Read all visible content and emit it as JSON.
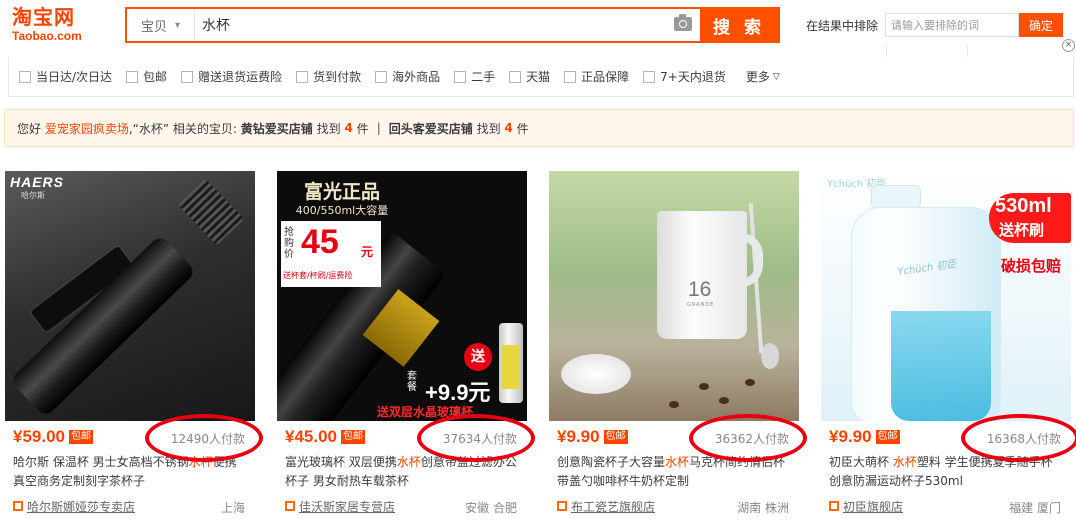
{
  "header": {
    "logo_cn": "淘宝网",
    "logo_en": "Taobao.com",
    "search_category": "宝贝",
    "search_query": "水杯",
    "search_button": "搜 索",
    "exclude_label": "在结果中排除",
    "exclude_placeholder": "请输入要排除的词",
    "exclude_button": "确定"
  },
  "filters": {
    "items": [
      {
        "label": "当日达/次日达"
      },
      {
        "label": "包邮"
      },
      {
        "label": "赠送退货运费险"
      },
      {
        "label": "货到付款"
      },
      {
        "label": "海外商品"
      },
      {
        "label": "二手"
      },
      {
        "label": "天猫"
      },
      {
        "label": "正品保障"
      },
      {
        "label": "7+天内退货"
      }
    ],
    "more": "更多"
  },
  "notice": {
    "greeting": "您好",
    "user": "爱宠家园疯卖场",
    "mid": ",“水杯” 相关的宝贝:",
    "shop1": "黄钻爱买店铺",
    "found1_pre": "找到",
    "count1": "4",
    "found1_post": "件",
    "divider": "|",
    "shop2": "回头客爱买店铺",
    "found2_pre": "找到",
    "count2": "4",
    "found2_post": "件"
  },
  "products": [
    {
      "price": "¥59.00",
      "badge": "包邮",
      "payers": "12490人付款",
      "title_pre": "哈尔斯 保温杯 男士女高档不锈钢",
      "title_hl": "水杯",
      "title_post": "便携真空商务定制刻字茶杯子",
      "shop": "哈尔斯娜娅莎专卖店",
      "location": "上海",
      "image": {
        "brand": "HAERS",
        "brand_sub": "哈尔斯"
      }
    },
    {
      "price": "¥45.00",
      "badge": "包邮",
      "payers": "37634人付款",
      "title_pre": "富光玻璃杯 双层便携",
      "title_hl": "水杯",
      "title_post": "创意带盖过滤办公杯子 男女耐热车载茶杯",
      "shop": "佳沃斯家居专营店",
      "location": "安徽 合肥",
      "image": {
        "title": "富光正品",
        "sub": "400/550ml大容量",
        "label": "抢购价",
        "price": "45",
        "unit": "元",
        "gift_note": "送杯套/杯刷/运费险",
        "gift_icon": "送",
        "gift_set": "套餐",
        "gift_price": "+9.9元",
        "gift_line": "送双层水晶玻璃杯"
      }
    },
    {
      "price": "¥9.90",
      "badge": "包邮",
      "payers": "36362人付款",
      "title_pre": "创意陶瓷杯子大容量",
      "title_hl": "水杯",
      "title_post": "马克杯简约情侣杯带盖勺咖啡杯牛奶杯定制",
      "shop": "布工瓷艺旗舰店",
      "location": "湖南 株洲",
      "image": {
        "mug_num": "16",
        "mug_sub": "GRANDE"
      }
    },
    {
      "price": "¥9.90",
      "badge": "包邮",
      "payers": "16368人付款",
      "title_pre": "初臣大萌杯 ",
      "title_hl": "水杯",
      "title_post": "塑料 学生便携夏季随手杯创意防漏运动杯子530ml",
      "shop": "初臣旗舰店",
      "location": "福建 厦门",
      "image": {
        "brand": "Ychüch 初臣",
        "sticker1": "530ml",
        "sticker2": "送杯刷",
        "sticker3": "破损包赔",
        "bottle_label": "Ychüch 初臣"
      }
    }
  ],
  "colors": {
    "accent": "#ff5000",
    "price": "#ff4400",
    "annotation": "#e60012"
  }
}
